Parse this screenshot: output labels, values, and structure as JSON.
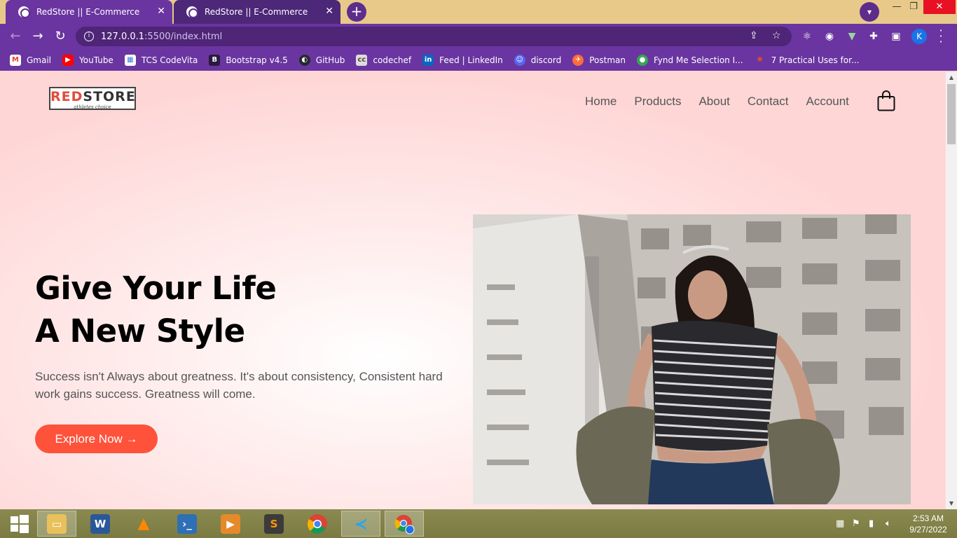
{
  "browser": {
    "tabs": [
      {
        "title": "RedStore || E-Commerce",
        "active": true
      },
      {
        "title": "RedStore || E-Commerce",
        "active": false
      }
    ],
    "url_host": "127.0.0.1",
    "url_path": ":5500/index.html",
    "profile_initial": "K",
    "bookmarks": [
      {
        "label": "Gmail",
        "icon": "gmail-icon",
        "color": "#ea4335"
      },
      {
        "label": "YouTube",
        "icon": "youtube-icon",
        "color": "#ff0000"
      },
      {
        "label": "TCS CodeVita",
        "icon": "tcs-icon",
        "color": "#3a7bd5"
      },
      {
        "label": "Bootstrap v4.5",
        "icon": "bootstrap-icon",
        "color": "#563d7c"
      },
      {
        "label": "GitHub",
        "icon": "github-icon",
        "color": "#24292e"
      },
      {
        "label": "codechef",
        "icon": "codechef-icon",
        "color": "#5b4638"
      },
      {
        "label": "Feed | LinkedIn",
        "icon": "linkedin-icon",
        "color": "#0a66c2"
      },
      {
        "label": "discord",
        "icon": "discord-icon",
        "color": "#5865f2"
      },
      {
        "label": "Postman",
        "icon": "postman-icon",
        "color": "#ff6c37"
      },
      {
        "label": "Fynd Me Selection I...",
        "icon": "fynd-icon",
        "color": "#34a853"
      },
      {
        "label": "7 Practical Uses for...",
        "icon": "practical-icon",
        "color": "#e34b2b"
      }
    ]
  },
  "page": {
    "logo": {
      "red": "RED",
      "rest": "STORE",
      "tagline": "athletes choice"
    },
    "nav": [
      "Home",
      "Products",
      "About",
      "Contact",
      "Account"
    ],
    "hero": {
      "title_line1": "Give Your Life",
      "title_line2": "A New Style",
      "text": "Success isn't Always about greatness. It's about consistency, Consistent hard work gains success. Greatness will come.",
      "cta": "Explore Now →"
    },
    "colors": {
      "accent": "#ff523b",
      "page_bg": "#ffd6d6",
      "browser_theme": "#6a35a0"
    }
  },
  "taskbar": {
    "apps": [
      "start-icon",
      "file-explorer-icon",
      "word-icon",
      "vlc-icon",
      "powershell-icon",
      "media-player-icon",
      "sublime-icon",
      "chrome-icon",
      "vscode-icon",
      "chrome-profile-icon"
    ],
    "time": "2:53 AM",
    "date": "9/27/2022"
  }
}
